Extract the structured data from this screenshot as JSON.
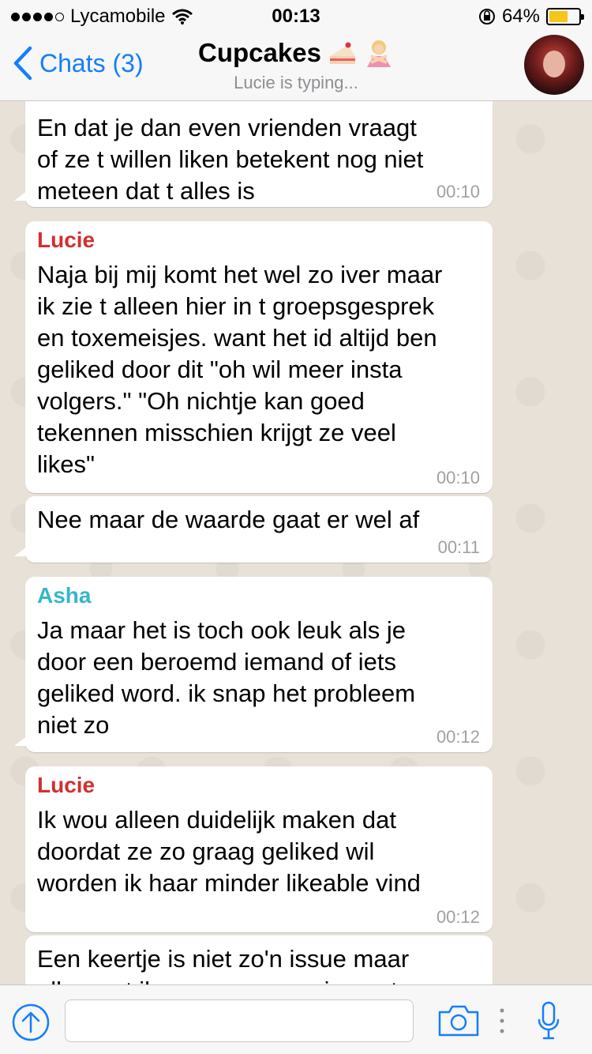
{
  "status_bar": {
    "carrier": "Lycamobile",
    "time": "00:13",
    "battery": "64%",
    "battery_level": 0.64
  },
  "nav": {
    "back_label": "Chats (3)",
    "title": "Cupcakes",
    "subtitle": "Lucie is typing..."
  },
  "messages": [
    {
      "sender": "",
      "text": "En dat je dan even vrienden vraagt\nof ze t willen liken betekent nog niet\nmeteen dat t alles is",
      "time": "00:10"
    },
    {
      "sender": "Lucie",
      "sender_color": "#d32f2f",
      "text": "Naja bij mij komt het wel zo iver maar\nik zie t alleen hier in t groepsgesprek\nen toxemeisjes. want het id altijd ben\ngeliked door dit \"oh wil meer insta\nvolgers.\" \"Oh nichtje kan goed\ntekennen misschien krijgt ze veel\nlikes\"",
      "time": "00:10"
    },
    {
      "sender": "",
      "text": "Nee maar de waarde gaat er wel af",
      "time": "00:11"
    },
    {
      "sender": "Asha",
      "sender_color": "#35b6c9",
      "text": "Ja maar het is toch ook leuk als je\ndoor een beroemd iemand of iets\ngeliked word. ik snap het probleem\nniet zo",
      "time": "00:12"
    },
    {
      "sender": "Lucie",
      "sender_color": "#d32f2f",
      "text": "Ik wou alleen duidelijk maken dat\ndoordat ze zo graag geliked wil\nworden ik haar minder likeable vind",
      "time": "00:12"
    },
    {
      "sender": "",
      "text": "Een keertje is niet zo'n issue maar\nalles wat ik er van zeena zie gaat om",
      "time": ""
    }
  ],
  "input": {
    "placeholder": ""
  },
  "icons": {
    "back": "chevron-left-icon",
    "upload": "arrow-up-circle-icon",
    "camera": "camera-icon",
    "more": "vertical-dots-icon",
    "mic": "microphone-icon"
  },
  "colors": {
    "accent": "#157efb",
    "lucie": "#d32f2f",
    "asha": "#35b6c9",
    "battery": "#f5c518"
  }
}
